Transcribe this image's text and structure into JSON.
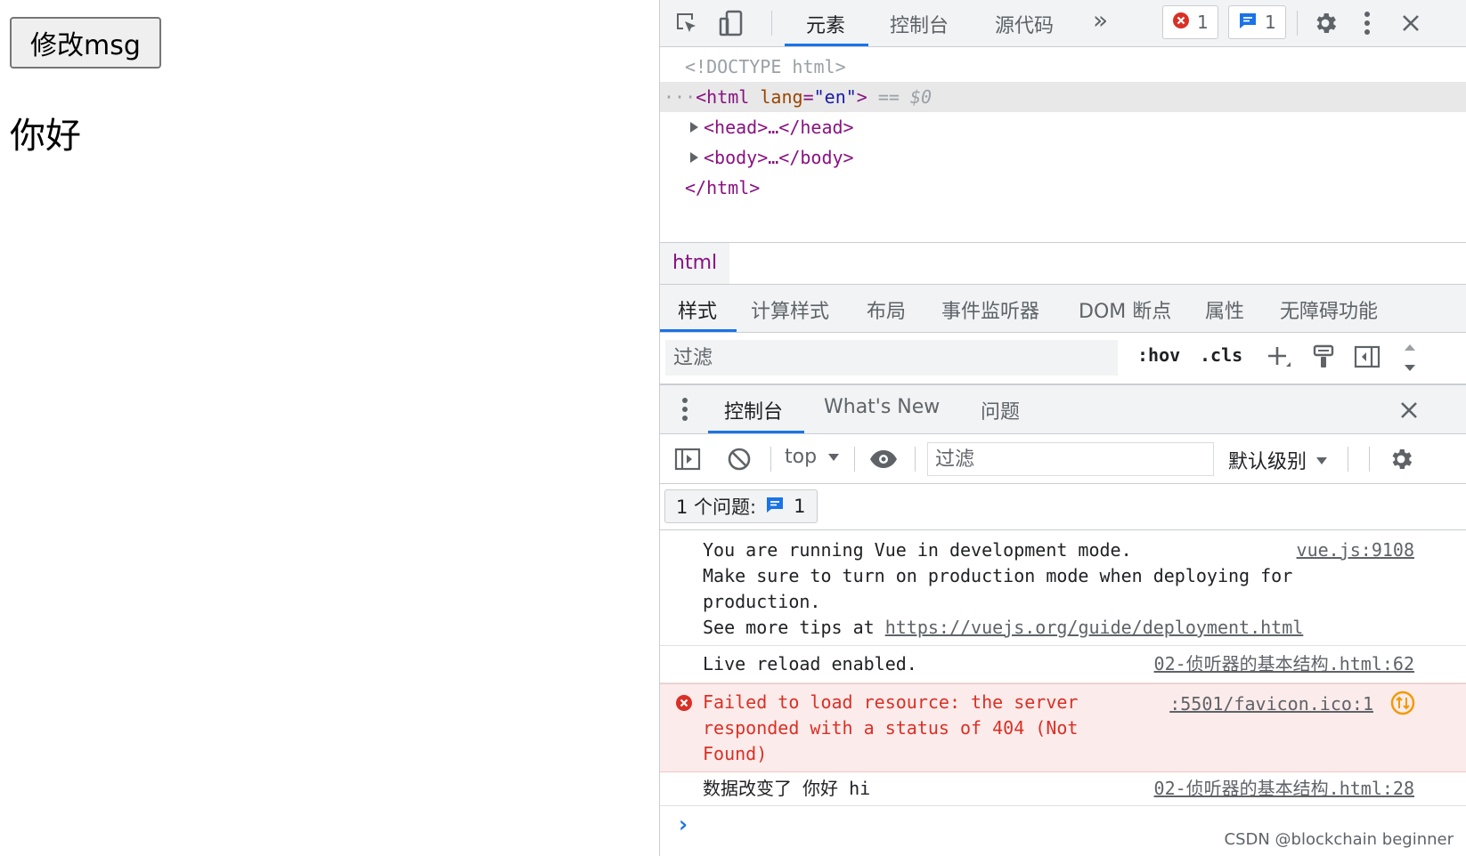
{
  "page": {
    "button_label": "修改msg",
    "message": "你好"
  },
  "devtools": {
    "top_tabs": [
      "元素",
      "控制台",
      "源代码"
    ],
    "more_tabs_glyph": "»",
    "error_count": "1",
    "message_count": "1",
    "dom": {
      "doctype": "<!DOCTYPE html>",
      "html_open_tag": "<html",
      "html_attr_name": "lang",
      "html_attr_value": "\"en\"",
      "html_close_bracket": ">",
      "selected_marker": "== $0",
      "head_collapsed": "<head>…</head>",
      "body_collapsed": "<body>…</body>",
      "html_close": "</html>"
    },
    "breadcrumb": "html",
    "styles_tabs": [
      "样式",
      "计算样式",
      "布局",
      "事件监听器",
      "DOM 断点",
      "属性",
      "无障碍功能"
    ],
    "styles_filter_placeholder": "过滤",
    "hov_label": ":hov",
    "cls_label": ".cls",
    "drawer_tabs": [
      "控制台",
      "What's New",
      "问题"
    ],
    "console_context": "top",
    "console_filter_placeholder": "过滤",
    "log_level": "默认级别",
    "issues_label": "1 个问题:",
    "issues_count": "1",
    "console_messages": [
      {
        "type": "info",
        "lines": [
          "You are running Vue in development mode.",
          "Make sure to turn on production mode when deploying for",
          "production.",
          "See more tips at "
        ],
        "link": "https://vuejs.org/guide/deployment.html",
        "source": "vue.js:9108"
      },
      {
        "type": "log",
        "lines": [
          "Live reload enabled."
        ],
        "source": "02-侦听器的基本结构.html:62"
      },
      {
        "type": "error",
        "lines": [
          "Failed to load resource: the server",
          "responded with a status of 404 (Not",
          "Found)"
        ],
        "source": ":5501/favicon.ico:1"
      },
      {
        "type": "log",
        "lines": [
          "数据改变了 你好 hi"
        ],
        "source": "02-侦听器的基本结构.html:28"
      }
    ],
    "prompt_glyph": "›"
  },
  "watermark": "CSDN @blockchain beginner",
  "colors": {
    "accent": "#1a73e8",
    "error": "#d93025",
    "error_bg": "#fcebeb",
    "warning": "#f29900"
  }
}
